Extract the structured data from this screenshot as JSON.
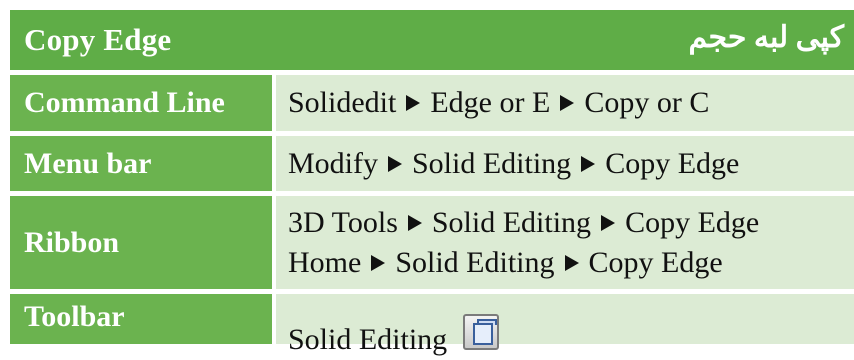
{
  "title": {
    "english": "Copy Edge",
    "persian": "کپی لبه حجم"
  },
  "rows": [
    {
      "label": "Command Line",
      "lines": [
        [
          "Solidedit",
          "Edge or E",
          "Copy or C"
        ]
      ]
    },
    {
      "label": "Menu bar",
      "lines": [
        [
          "Modify",
          "Solid Editing",
          "Copy Edge"
        ]
      ]
    },
    {
      "label": "Ribbon",
      "lines": [
        [
          "3D Tools",
          "Solid Editing",
          "Copy Edge"
        ],
        [
          "Home",
          "Solid Editing",
          "Copy Edge"
        ]
      ]
    },
    {
      "label": "Toolbar",
      "text": "Solid Editing",
      "icon": "copy-edge-toolbar-icon"
    }
  ],
  "colors": {
    "header_green": "#5fad47",
    "label_green": "#6bb34f",
    "value_bg": "#dcebd4"
  }
}
